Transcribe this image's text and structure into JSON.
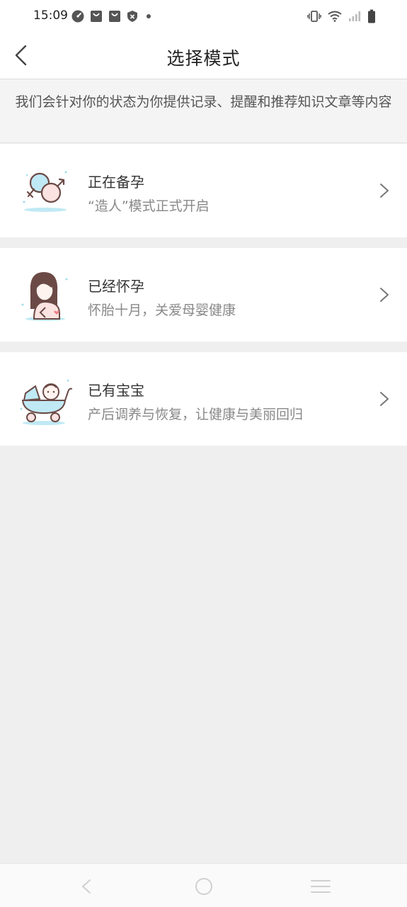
{
  "status_bar": {
    "time": "15:09",
    "left_icons": [
      "speedometer-icon",
      "shopping-bag-icon",
      "shopping-bag-icon",
      "shield-icon",
      "dot-icon"
    ],
    "right_icons": [
      "vibrate-icon",
      "wifi-icon",
      "signal-icon",
      "battery-icon"
    ]
  },
  "header": {
    "back_icon": "back-arrow-icon",
    "title": "选择模式"
  },
  "notice": {
    "text": "我们会针对你的状态为你提供记录、提醒和推荐知识文章等内容"
  },
  "modes": [
    {
      "title": "正在备孕",
      "subtitle": "“造人”模式正式开启",
      "icon": "gender-symbols-icon"
    },
    {
      "title": "已经怀孕",
      "subtitle": "怀胎十月，关爱母婴健康",
      "icon": "pregnant-woman-icon"
    },
    {
      "title": "已有宝宝",
      "subtitle": "产后调养与恢复，让健康与美丽回归",
      "icon": "baby-stroller-icon"
    }
  ],
  "nav_bar": {
    "icons": [
      "nav-back-icon",
      "nav-home-icon",
      "nav-menu-icon"
    ]
  },
  "colors": {
    "page_bg": "#efefef",
    "card_bg": "#ffffff",
    "accent_blue": "#bfe9f4",
    "accent_pink": "#f7c9c9",
    "outline": "#6b4a46"
  }
}
